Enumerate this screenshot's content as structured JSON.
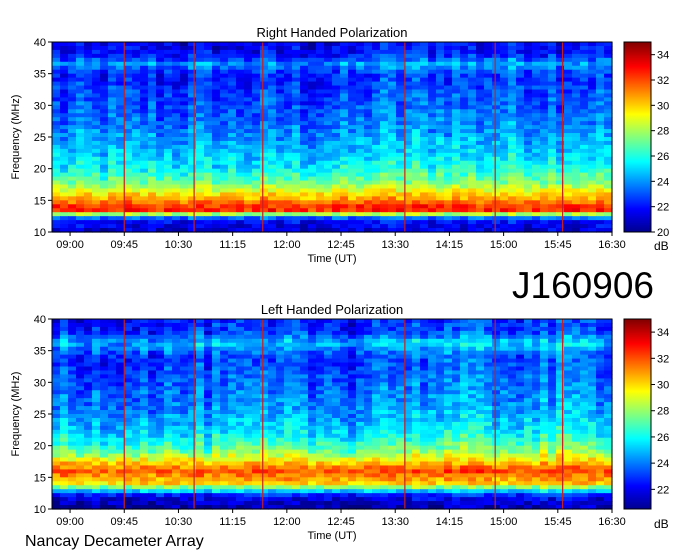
{
  "header": {
    "observation_id": "J160906",
    "instrument": "Nancay Decameter Array"
  },
  "chart_data": [
    {
      "type": "heatmap",
      "title": "Right Handed Polarization",
      "xlabel": "Time (UT)",
      "ylabel": "Frequency (MHz)",
      "x_ticks": [
        "09:00",
        "09:45",
        "10:30",
        "11:15",
        "12:00",
        "12:45",
        "13:30",
        "14:15",
        "15:00",
        "15:45",
        "16:30"
      ],
      "y_ticks": [
        10,
        15,
        20,
        25,
        30,
        35,
        40
      ],
      "xlim": [
        "08:45",
        "16:30"
      ],
      "ylim": [
        10,
        40
      ],
      "colorbar": {
        "label": "dB",
        "ticks": [
          20,
          22,
          24,
          26,
          28,
          30,
          32,
          34
        ],
        "range": [
          20,
          35
        ]
      },
      "vertical_markers": [
        "09:45",
        "10:43",
        "11:40",
        "13:38",
        "14:53",
        "15:49"
      ],
      "band_profile": [
        {
          "freq": 10,
          "db": 21
        },
        {
          "freq": 12,
          "db": 22
        },
        {
          "freq": 13.5,
          "db": 33
        },
        {
          "freq": 15,
          "db": 31
        },
        {
          "freq": 16.5,
          "db": 29
        },
        {
          "freq": 18,
          "db": 27
        },
        {
          "freq": 20,
          "db": 25.5
        },
        {
          "freq": 22,
          "db": 24.8
        },
        {
          "freq": 25,
          "db": 24
        },
        {
          "freq": 28,
          "db": 23.2
        },
        {
          "freq": 32,
          "db": 22.6
        },
        {
          "freq": 35,
          "db": 22.2
        },
        {
          "freq": 36.5,
          "db": 24
        },
        {
          "freq": 38,
          "db": 21.8
        },
        {
          "freq": 40,
          "db": 21.5
        }
      ]
    },
    {
      "type": "heatmap",
      "title": "Left Handed Polarization",
      "xlabel": "Time (UT)",
      "ylabel": "Frequency (MHz)",
      "x_ticks": [
        "09:00",
        "09:45",
        "10:30",
        "11:15",
        "12:00",
        "12:45",
        "13:30",
        "14:15",
        "15:00",
        "15:45",
        "16:30"
      ],
      "y_ticks": [
        10,
        15,
        20,
        25,
        30,
        35,
        40
      ],
      "xlim": [
        "08:45",
        "16:30"
      ],
      "ylim": [
        10,
        40
      ],
      "colorbar": {
        "label": "dB",
        "ticks": [
          22,
          24,
          26,
          28,
          30,
          32,
          34
        ],
        "range": [
          20.5,
          35
        ]
      },
      "vertical_markers": [
        "09:45",
        "10:43",
        "11:40",
        "13:38",
        "14:53",
        "15:49"
      ],
      "band_profile": [
        {
          "freq": 10,
          "db": 21
        },
        {
          "freq": 12,
          "db": 22
        },
        {
          "freq": 14,
          "db": 30
        },
        {
          "freq": 16,
          "db": 32
        },
        {
          "freq": 17.5,
          "db": 30
        },
        {
          "freq": 19,
          "db": 27.5
        },
        {
          "freq": 21,
          "db": 26
        },
        {
          "freq": 23,
          "db": 25
        },
        {
          "freq": 26,
          "db": 24.2
        },
        {
          "freq": 30,
          "db": 23.5
        },
        {
          "freq": 34,
          "db": 23
        },
        {
          "freq": 36.2,
          "db": 25
        },
        {
          "freq": 38,
          "db": 22.8
        },
        {
          "freq": 40,
          "db": 22.5
        }
      ]
    }
  ]
}
